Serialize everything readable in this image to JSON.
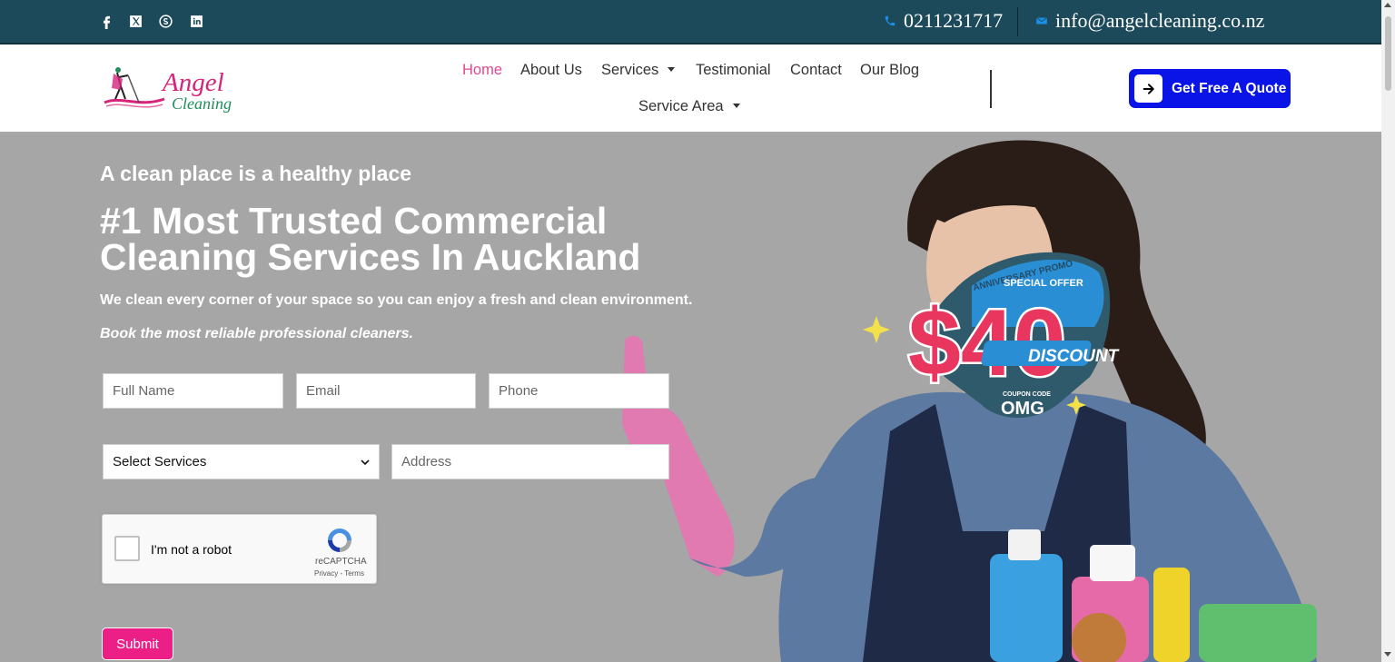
{
  "colors": {
    "topbar_bg": "#1d4a5a",
    "accent_pink": "#e0488f",
    "quote_button": "#0a14e6",
    "submit_button": "#ec1f87",
    "hero_bg": "#a6a6a6"
  },
  "topbar": {
    "social_icons": [
      "facebook-icon",
      "x-twitter-icon",
      "skype-icon",
      "linkedin-icon"
    ],
    "phone": "0211231717",
    "email": "info@angelcleaning.co.nz"
  },
  "logo": {
    "line1": "Angel",
    "line2": "Cleaning"
  },
  "nav": {
    "home": "Home",
    "about": "About Us",
    "services": "Services",
    "testimonial": "Testimonial",
    "contact": "Contact",
    "blog": "Our Blog",
    "service_area": "Service Area",
    "quote_button": "Get Free A Quote"
  },
  "hero": {
    "tagline": "A clean place is a healthy place",
    "headline": "#1 Most Trusted Commercial Cleaning Services In Auckland",
    "subtext": "We clean every corner of your space so you can enjoy a fresh and clean environment.",
    "subtext2": "Book the most reliable professional cleaners.",
    "promo": {
      "arc_text": "ANNIVERSARY PROMO",
      "special": "SPECIAL OFFER",
      "amount": "$40",
      "discount": "DISCOUNT",
      "coupon_label": "COUPON CODE",
      "coupon_code": "OMG"
    }
  },
  "form": {
    "full_name_placeholder": "Full Name",
    "email_placeholder": "Email",
    "phone_placeholder": "Phone",
    "select_value": "Select Services",
    "address_placeholder": "Address",
    "captcha_label": "I'm not a robot",
    "captcha_brand": "reCAPTCHA",
    "captcha_links": "Privacy - Terms",
    "submit_label": "Submit"
  }
}
